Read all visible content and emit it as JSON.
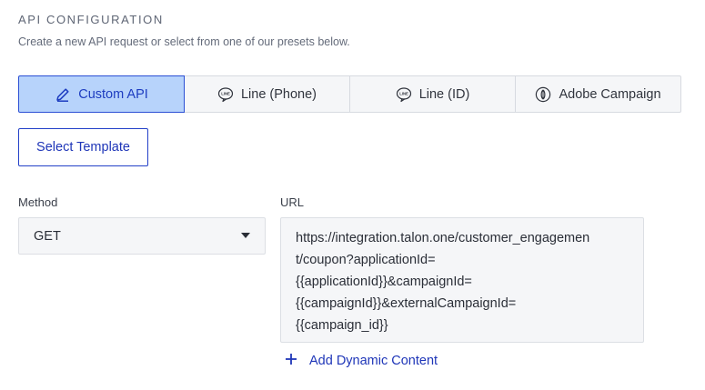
{
  "section": {
    "title": "API CONFIGURATION",
    "subtitle": "Create a new API request or select from one of our presets below."
  },
  "presets": [
    {
      "label": "Custom API",
      "icon": "pencil-icon",
      "active": true
    },
    {
      "label": "Line (Phone)",
      "icon": "line-logo-icon",
      "active": false
    },
    {
      "label": "Line (ID)",
      "icon": "line-logo-icon",
      "active": false
    },
    {
      "label": "Adobe Campaign",
      "icon": "adobe-campaign-icon",
      "active": false
    }
  ],
  "template_button": {
    "label": "Select Template"
  },
  "method": {
    "label": "Method",
    "value": "GET"
  },
  "url": {
    "label": "URL",
    "lines": [
      "https://integration.talon.one/customer_engagemen",
      "t/coupon?applicationId=",
      "{{applicationId}}&campaignId=",
      "{{campaignId}}&externalCampaignId=",
      "{{campaign_id}}"
    ]
  },
  "add_dynamic": {
    "label": "Add Dynamic Content"
  },
  "colors": {
    "accent": "#1f36b8",
    "active_bg": "#b7d3fb",
    "field_bg": "#f5f6f8"
  }
}
